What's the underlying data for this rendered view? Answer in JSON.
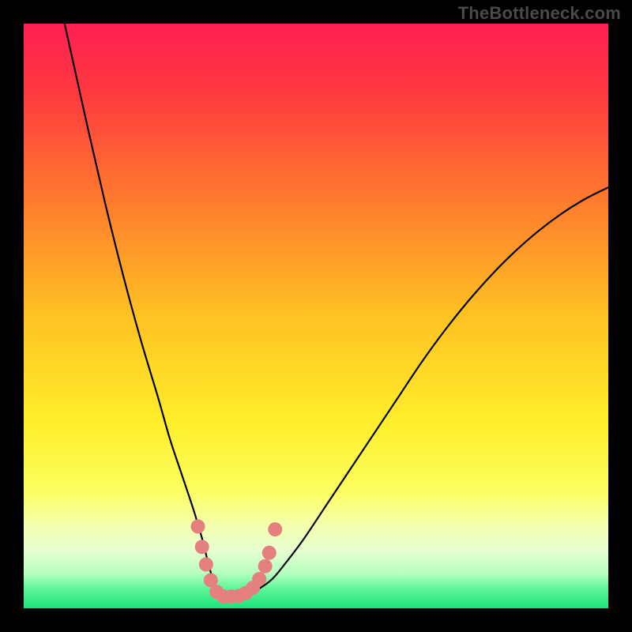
{
  "watermark": {
    "text": "TheBottleneck.com"
  },
  "colors": {
    "frame": "#000000",
    "curve": "#000000",
    "markers": "#e58080",
    "gradient_stops": [
      {
        "offset": 0.0,
        "color": "#ff1f52"
      },
      {
        "offset": 0.12,
        "color": "#ff3a3f"
      },
      {
        "offset": 0.3,
        "color": "#ff7a2e"
      },
      {
        "offset": 0.5,
        "color": "#ffc223"
      },
      {
        "offset": 0.68,
        "color": "#ffee2a"
      },
      {
        "offset": 0.8,
        "color": "#fbff60"
      },
      {
        "offset": 0.86,
        "color": "#f5ffb0"
      },
      {
        "offset": 0.9,
        "color": "#e8ffd0"
      },
      {
        "offset": 0.94,
        "color": "#b6ffc0"
      },
      {
        "offset": 0.965,
        "color": "#63f59a"
      },
      {
        "offset": 1.0,
        "color": "#18e47a"
      }
    ]
  },
  "chart_data": {
    "type": "line",
    "title": "",
    "xlabel": "",
    "ylabel": "",
    "xlim": [
      0,
      100
    ],
    "ylim": [
      0,
      100
    ],
    "series": [
      {
        "name": "curve",
        "x": [
          7.0,
          9.0,
          11.0,
          14.0,
          17.0,
          20.0,
          23.0,
          25.0,
          27.0,
          29.0,
          30.5,
          31.5,
          32.5,
          33.5,
          34.5,
          36.0,
          38.0,
          40.0,
          42.5,
          45.0,
          48.0,
          52.0,
          56.0,
          60.0,
          64.0,
          68.0,
          72.0,
          76.0,
          80.0,
          84.0,
          88.0,
          92.0,
          96.0,
          100.0
        ],
        "y": [
          100.0,
          91.0,
          82.0,
          69.0,
          57.0,
          46.0,
          36.0,
          29.0,
          23.0,
          17.0,
          12.0,
          8.0,
          4.5,
          2.5,
          2.0,
          2.0,
          2.3,
          3.2,
          5.0,
          8.0,
          12.0,
          18.0,
          24.0,
          30.0,
          36.0,
          42.0,
          47.5,
          52.5,
          57.0,
          61.0,
          64.5,
          67.5,
          70.0,
          72.0
        ]
      }
    ],
    "markers": {
      "name": "highlighted-points",
      "color": "#e58080",
      "points": [
        {
          "x": 29.8,
          "y": 14.0
        },
        {
          "x": 30.5,
          "y": 10.5
        },
        {
          "x": 31.2,
          "y": 7.5
        },
        {
          "x": 32.0,
          "y": 4.8
        },
        {
          "x": 33.0,
          "y": 2.8
        },
        {
          "x": 34.2,
          "y": 2.0
        },
        {
          "x": 35.5,
          "y": 2.0
        },
        {
          "x": 36.8,
          "y": 2.1
        },
        {
          "x": 38.0,
          "y": 2.6
        },
        {
          "x": 39.2,
          "y": 3.5
        },
        {
          "x": 40.3,
          "y": 5.0
        },
        {
          "x": 41.3,
          "y": 7.2
        },
        {
          "x": 42.0,
          "y": 9.5
        },
        {
          "x": 43.0,
          "y": 13.5
        }
      ]
    },
    "grid": false,
    "legend": false
  }
}
